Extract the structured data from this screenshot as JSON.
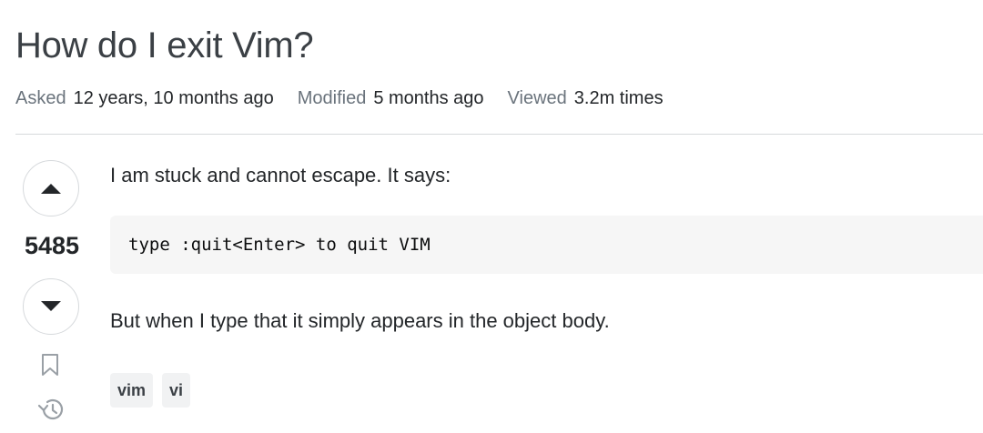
{
  "question": {
    "title": "How do I exit Vim?",
    "meta": {
      "asked_label": "Asked",
      "asked_value": "12 years, 10 months ago",
      "modified_label": "Modified",
      "modified_value": "5 months ago",
      "viewed_label": "Viewed",
      "viewed_value": "3.2m times"
    },
    "votes": {
      "count": "5485",
      "upvote_icon": "triangle-up-icon",
      "downvote_icon": "triangle-down-icon",
      "bookmark_icon": "bookmark-icon",
      "history_icon": "history-icon"
    },
    "body": {
      "paragraph_1": "I am stuck and cannot escape. It says:",
      "code": "type :quit<Enter> to quit VIM",
      "paragraph_2": "But when I type that it simply appears in the object body."
    },
    "tags": [
      {
        "label": "vim"
      },
      {
        "label": "vi"
      }
    ]
  },
  "colors": {
    "text": "#232629",
    "muted": "#6a737c",
    "border": "#d6d9dc",
    "code_bg": "#f6f6f6",
    "tag_bg": "#f1f2f3"
  }
}
